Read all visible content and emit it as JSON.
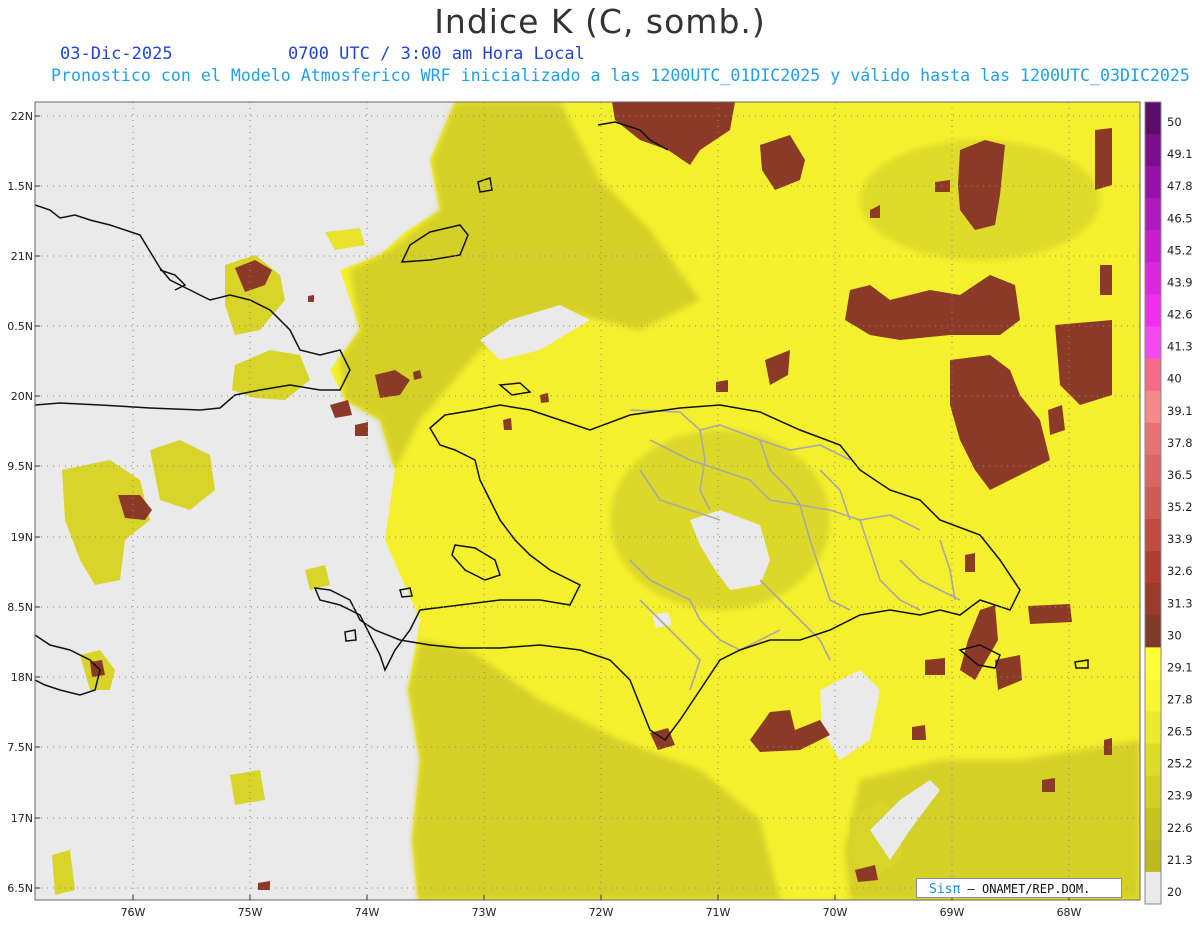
{
  "title": "Indice K (C, somb.)",
  "date_label": "03-Dic-2025",
  "time_label": "0700 UTC / 3:00 am Hora Local",
  "description": "Pronostico con el Modelo Atmosferico WRF inicializado a las 1200UTC_01DIC2025 y válido hasta las  1200UTC_03DIC2025",
  "credit": {
    "sis": "Sisπ",
    "rest": " – ONAMET/REP.DOM."
  },
  "axes": {
    "lat_ticks": [
      "22N",
      "1.5N",
      "21N",
      "0.5N",
      "20N",
      "9.5N",
      "19N",
      "8.5N",
      "18N",
      "7.5N",
      "17N",
      "6.5N"
    ],
    "lon_ticks": [
      "76W",
      "75W",
      "74W",
      "73W",
      "72W",
      "71W",
      "70W",
      "69W",
      "68W"
    ]
  },
  "colorbar": {
    "labels": [
      "50",
      "49.1",
      "47.8",
      "46.5",
      "45.2",
      "43.9",
      "42.6",
      "41.3",
      "40",
      "39.1",
      "37.8",
      "36.5",
      "35.2",
      "33.9",
      "32.6",
      "31.3",
      "30",
      "29.1",
      "27.8",
      "26.5",
      "25.2",
      "23.9",
      "22.6",
      "21.3",
      "20"
    ],
    "colors": [
      "#5c0c6c",
      "#7a0e8c",
      "#9612a8",
      "#b018c0",
      "#c81ed2",
      "#dc26e0",
      "#ee30ee",
      "#f548f0",
      "#f86a88",
      "#f58a8a",
      "#e87272",
      "#dc6464",
      "#cf5a52",
      "#c24a3e",
      "#b03e30",
      "#9a3a28",
      "#803a28",
      "#ffff38",
      "#f8f532",
      "#ecea2c",
      "#dedc28",
      "#d2d024",
      "#c5c320",
      "#bcb81e",
      "#eaeaea"
    ]
  },
  "colors": {
    "land_gray": "#eaeaea",
    "field_yellow": "#f4f02e",
    "field_olive": "#d0cb27",
    "storm_brown": "#8b3a28",
    "coast": "#111111",
    "province_border": "#a8a8a8"
  }
}
